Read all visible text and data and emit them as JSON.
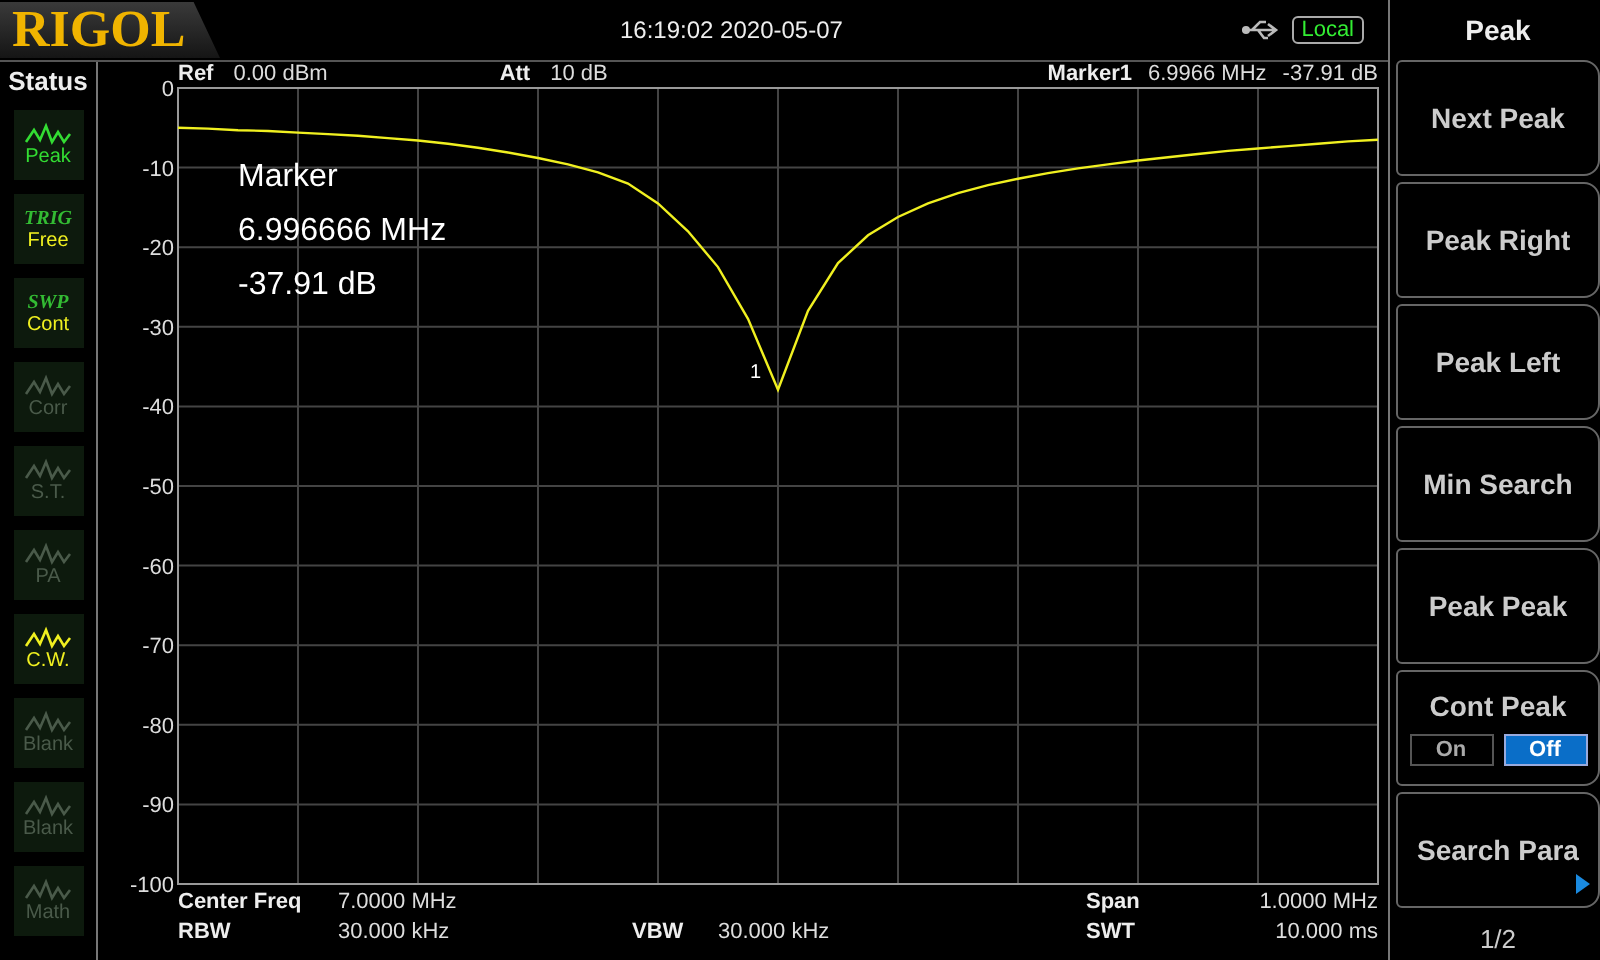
{
  "header": {
    "logo": "RIGOL",
    "datetime": "16:19:02 2020-05-07",
    "remote": "Local"
  },
  "status": {
    "title": "Status",
    "items": [
      {
        "kind": "icon",
        "label": "Peak",
        "color": "#33dd33"
      },
      {
        "kind": "text",
        "heading": "TRIG",
        "label": "Free",
        "color": "#f0f020"
      },
      {
        "kind": "text",
        "heading": "SWP",
        "label": "Cont",
        "color": "#f0f020"
      },
      {
        "kind": "icon",
        "label": "Corr",
        "color": "#4a5a4a"
      },
      {
        "kind": "icon",
        "label": "S.T.",
        "color": "#4a5a4a"
      },
      {
        "kind": "icon",
        "label": "PA",
        "color": "#4a5a4a"
      },
      {
        "kind": "icon",
        "label": "C.W.",
        "color": "#f0f020"
      },
      {
        "kind": "icon",
        "label": "Blank",
        "color": "#4a5a4a"
      },
      {
        "kind": "icon",
        "label": "Blank",
        "color": "#4a5a4a"
      },
      {
        "kind": "icon",
        "label": "Math",
        "color": "#4a5a4a"
      }
    ]
  },
  "info_top": [
    {
      "label": "Ref",
      "value": "0.00 dBm"
    },
    {
      "label": "Att",
      "value": "10 dB"
    },
    {
      "label": "Marker1",
      "values": [
        "6.9966 MHz",
        "-37.91 dB"
      ]
    }
  ],
  "marker_readout": [
    "Marker",
    "6.996666 MHz",
    "-37.91 dB"
  ],
  "chart_data": {
    "type": "line",
    "grid": true,
    "ylim": [
      -100,
      0
    ],
    "yticks": [
      0,
      -10,
      -20,
      -30,
      -40,
      -50,
      -60,
      -70,
      -80,
      -90,
      -100
    ],
    "series": [
      {
        "color": "#f0f020",
        "values": [
          -5.0,
          -5.1,
          -5.3,
          -5.4,
          -5.6,
          -5.8,
          -6.0,
          -6.3,
          -6.6,
          -7.0,
          -7.5,
          -8.1,
          -8.8,
          -9.6,
          -10.6,
          -12.0,
          -14.5,
          -18.0,
          -22.5,
          -29.0,
          -37.9,
          -28.0,
          -22.0,
          -18.5,
          -16.2,
          -14.5,
          -13.2,
          -12.2,
          -11.4,
          -10.7,
          -10.1,
          -9.6,
          -9.1,
          -8.7,
          -8.3,
          -7.9,
          -7.6,
          -7.3,
          -7.0,
          -6.7,
          -6.5
        ]
      }
    ],
    "annotations": [
      "1"
    ]
  },
  "info_bottom": [
    [
      {
        "label": "Center Freq",
        "value": "7.0000 MHz"
      },
      {
        "label": "Span",
        "value": "1.0000 MHz"
      }
    ],
    [
      {
        "label": "RBW",
        "value": "30.000 kHz"
      },
      {
        "label": "VBW",
        "value": "30.000 kHz"
      },
      {
        "label": "SWT",
        "value": "10.000 ms"
      }
    ]
  ],
  "softkeys": {
    "title": "Peak",
    "items": [
      {
        "kind": "plain",
        "label": "Next Peak"
      },
      {
        "kind": "plain",
        "label": "Peak Right"
      },
      {
        "kind": "plain",
        "label": "Peak Left"
      },
      {
        "kind": "plain",
        "label": "Min Search"
      },
      {
        "kind": "plain",
        "label": "Peak Peak"
      },
      {
        "kind": "toggle",
        "label": "Cont Peak",
        "options": [
          {
            "label": "On",
            "selected": false
          },
          {
            "label": "Off",
            "selected": true
          }
        ]
      },
      {
        "kind": "submenu",
        "label": "Search Para"
      }
    ],
    "page": "1/2"
  }
}
